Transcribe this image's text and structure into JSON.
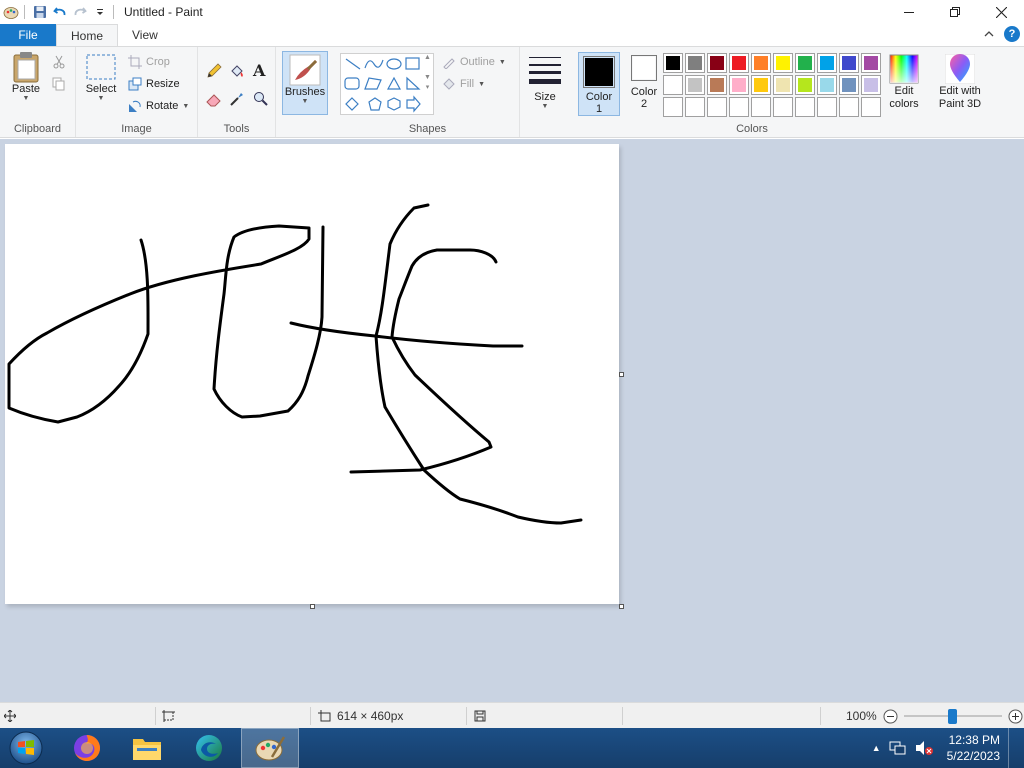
{
  "window": {
    "title": "Untitled - Paint"
  },
  "tabs": [
    {
      "label": "File"
    },
    {
      "label": "Home"
    },
    {
      "label": "View"
    }
  ],
  "clipboard": {
    "paste_label": "Paste",
    "group_label": "Clipboard"
  },
  "image": {
    "select_label": "Select",
    "crop_label": "Crop",
    "resize_label": "Resize",
    "rotate_label": "Rotate",
    "group_label": "Image"
  },
  "tools": {
    "group_label": "Tools"
  },
  "brushes": {
    "label": "Brushes"
  },
  "shapes": {
    "outline_label": "Outline",
    "fill_label": "Fill",
    "group_label": "Shapes"
  },
  "size": {
    "label": "Size"
  },
  "colors": {
    "color1_label": "Color 1",
    "color2_label": "Color 2",
    "edit_colors_label": "Edit colors",
    "edit_paint3d_label": "Edit with Paint 3D",
    "group_label": "Colors",
    "color1_value": "#000000",
    "color2_value": "#ffffff",
    "palette": [
      "#000000",
      "#7f7f7f",
      "#880015",
      "#ed1c24",
      "#ff7f27",
      "#fff200",
      "#22b14c",
      "#00a2e8",
      "#3f48cc",
      "#a349a4",
      "#ffffff",
      "#c3c3c3",
      "#b97a57",
      "#ffaec9",
      "#ffc90e",
      "#efe4b0",
      "#b5e61d",
      "#99d9ea",
      "#7092be",
      "#c8bfe7",
      "",
      "",
      "",
      "",
      "",
      "",
      "",
      "",
      "",
      ""
    ]
  },
  "status": {
    "canvas_size": "614 × 460px",
    "zoom": "100%",
    "zoom_level": 0.5
  },
  "taskbar": {
    "time": "12:38 PM",
    "date": "5/22/2023"
  }
}
